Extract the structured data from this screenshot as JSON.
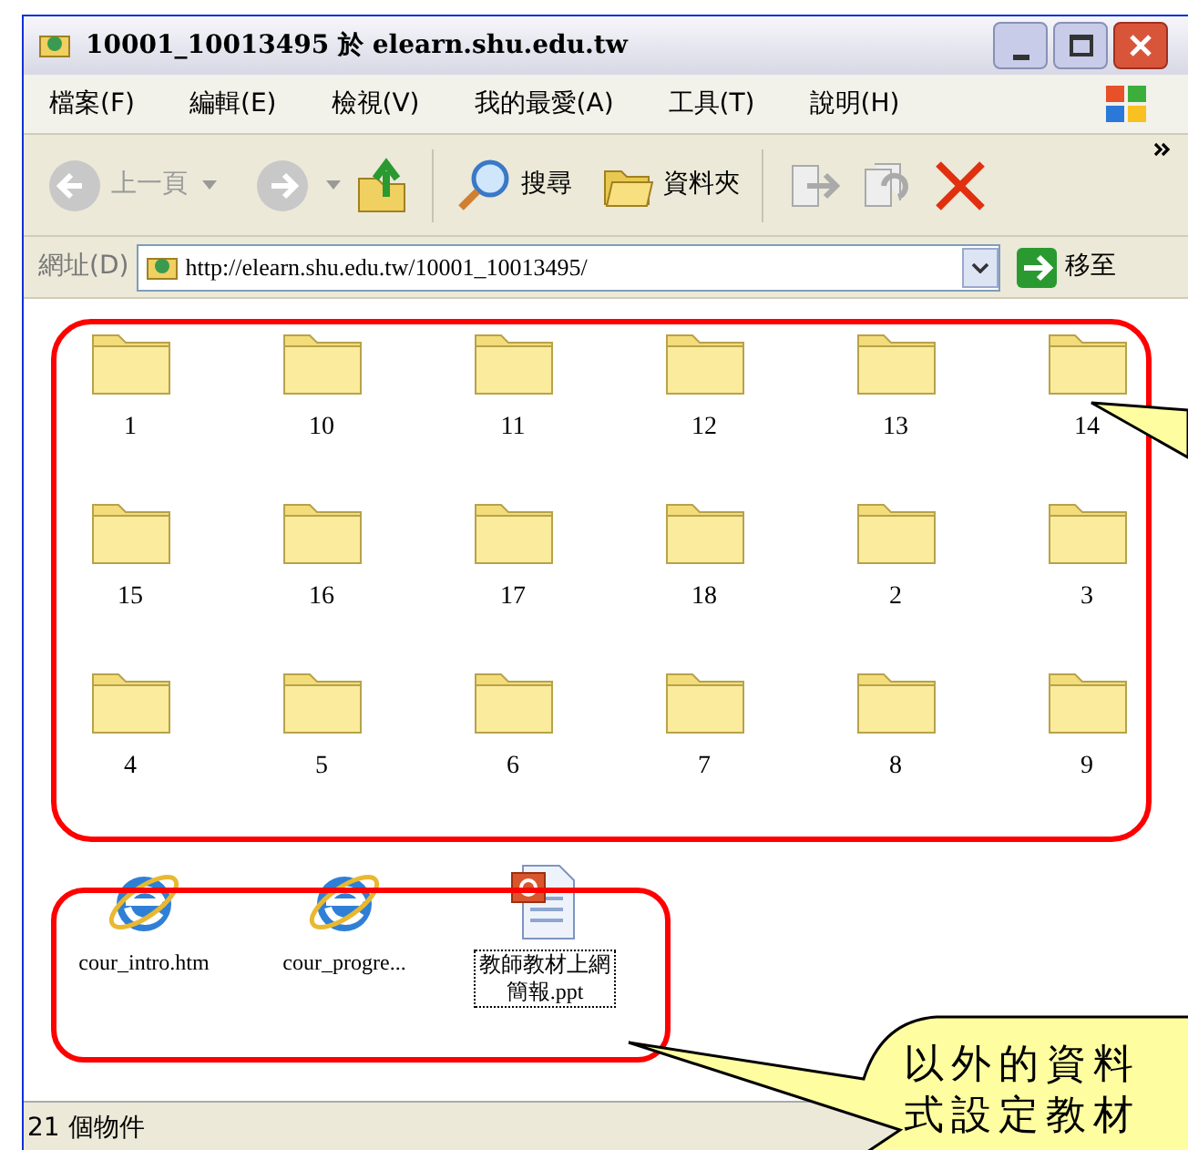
{
  "window": {
    "title": "10001_10013495 於 elearn.shu.edu.tw"
  },
  "menu": [
    "檔案(F)",
    "編輯(E)",
    "檢視(V)",
    "我的最愛(A)",
    "工具(T)",
    "說明(H)"
  ],
  "toolbar": {
    "back": "上一頁",
    "search": "搜尋",
    "folders": "資料夾"
  },
  "address": {
    "label": "網址(D)",
    "value": "http://elearn.shu.edu.tw/10001_10013495/",
    "go": "移至"
  },
  "folders": [
    {
      "name": "1"
    },
    {
      "name": "10"
    },
    {
      "name": "11"
    },
    {
      "name": "12"
    },
    {
      "name": "13"
    },
    {
      "name": "14"
    },
    {
      "name": "15"
    },
    {
      "name": "16"
    },
    {
      "name": "17"
    },
    {
      "name": "18"
    },
    {
      "name": "2"
    },
    {
      "name": "3"
    },
    {
      "name": "4"
    },
    {
      "name": "5"
    },
    {
      "name": "6"
    },
    {
      "name": "7"
    },
    {
      "name": "8"
    },
    {
      "name": "9"
    }
  ],
  "files": [
    {
      "name": "cour_intro.htm",
      "kind": "web",
      "selected": false
    },
    {
      "name": "cour_progre...",
      "kind": "web",
      "selected": false
    },
    {
      "name": "教師教材上網簡報.ppt",
      "kind": "slides",
      "selected": true
    }
  ],
  "status_bar": {
    "text": "21 個物件"
  },
  "callout": {
    "lines": [
      "以外的資料",
      "式設定教材"
    ]
  }
}
